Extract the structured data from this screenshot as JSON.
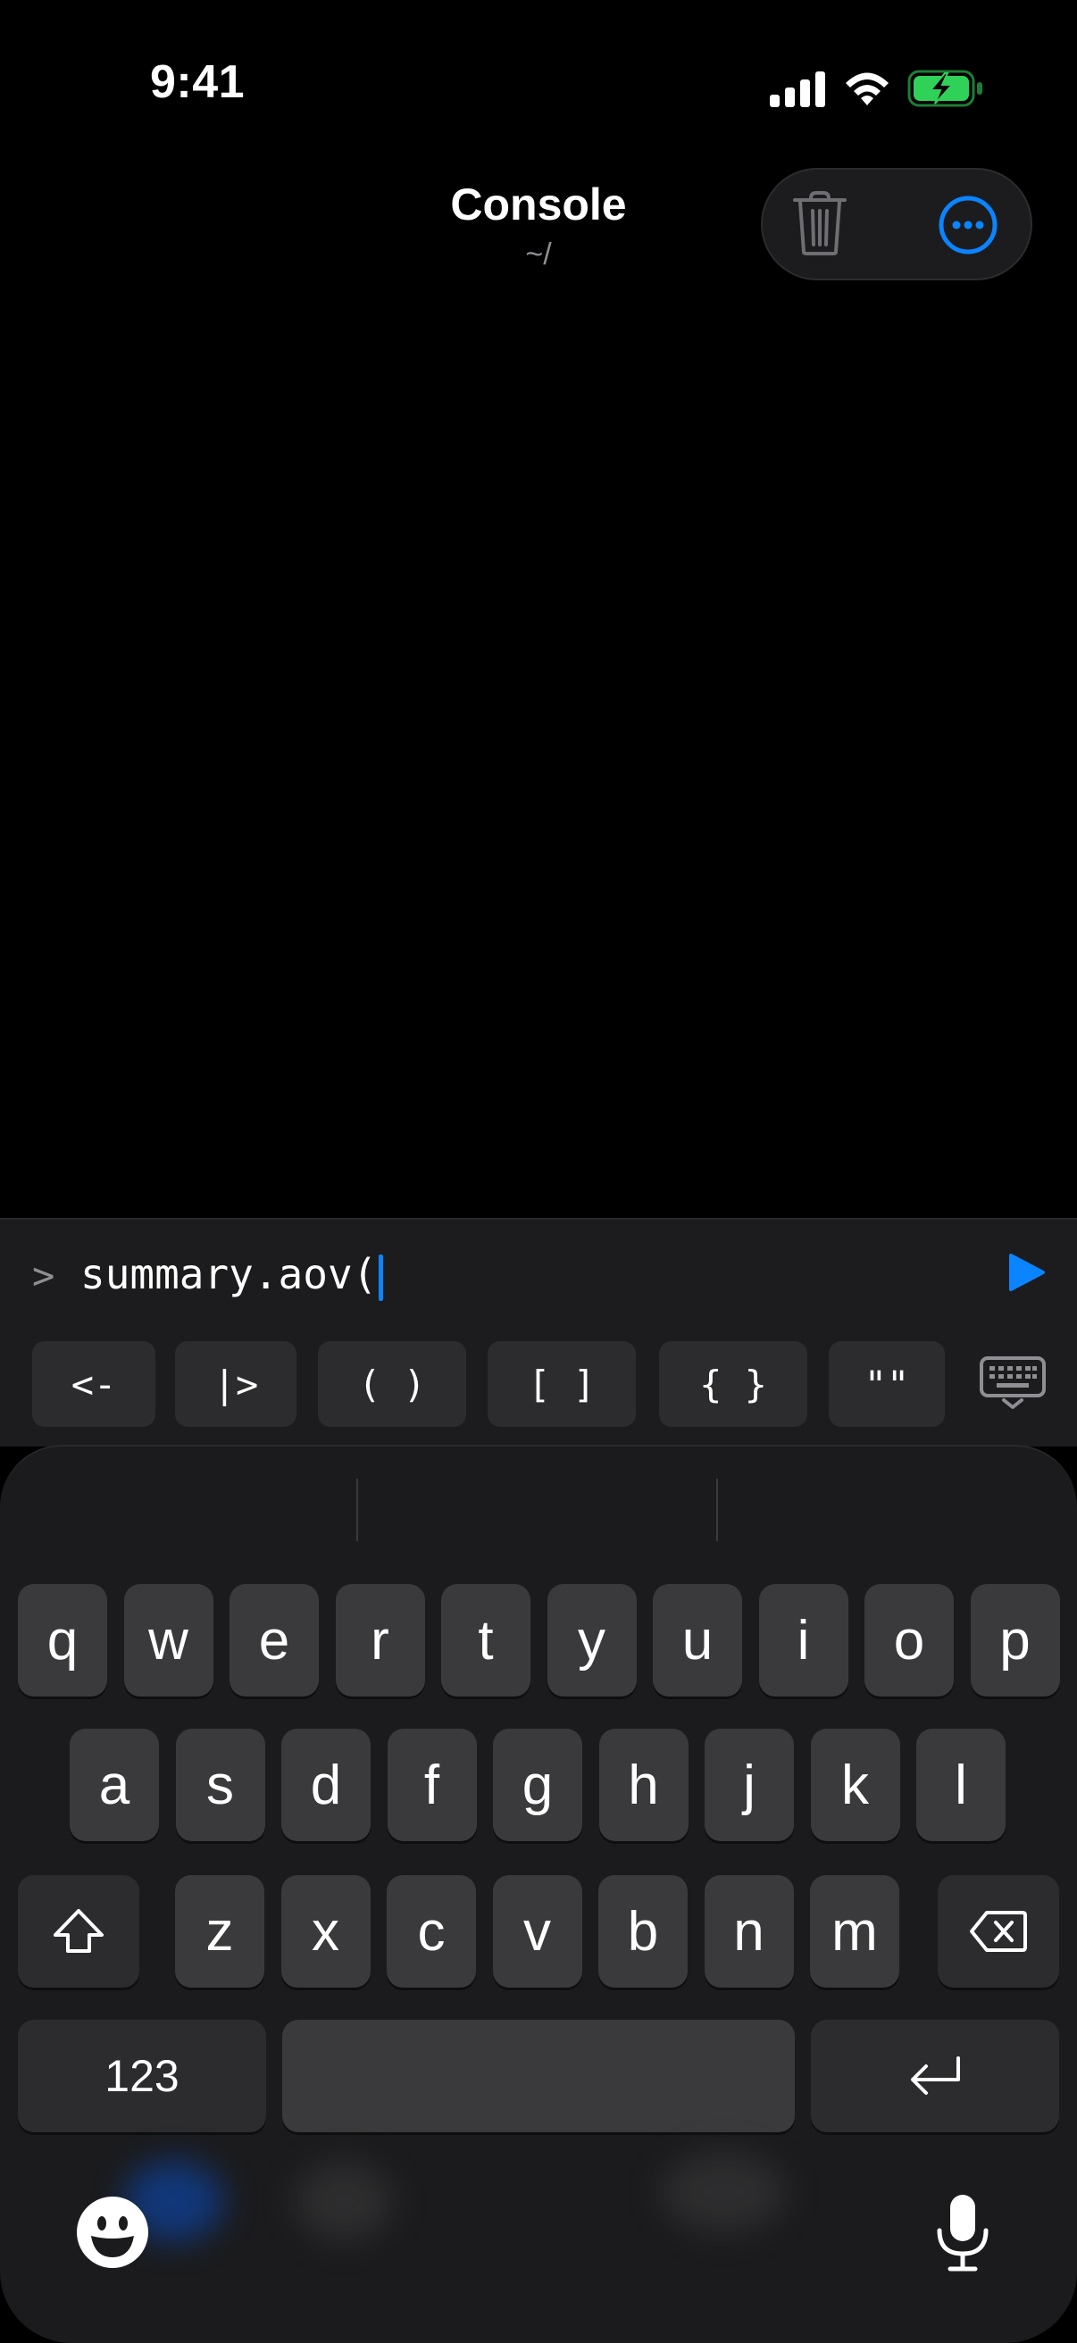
{
  "status_bar": {
    "time": "9:41",
    "icons": [
      "cellular-signal-icon",
      "wifi-icon",
      "battery-charging-icon"
    ],
    "battery_color": "#30d158"
  },
  "nav": {
    "title": "Console",
    "subtitle": "~/",
    "actions": [
      "trash-icon",
      "more-icon"
    ],
    "accent": "#0a84ff"
  },
  "console": {
    "prompt": ">",
    "command": "summary.aov(",
    "run_icon": "play-icon"
  },
  "accessory_keys": [
    "<-",
    "|>",
    "( )",
    "[ ]",
    "{ }",
    "\"\"",
    "keyboard-dismiss-icon"
  ],
  "keyboard": {
    "row1": [
      "q",
      "w",
      "e",
      "r",
      "t",
      "y",
      "u",
      "i",
      "o",
      "p"
    ],
    "row2": [
      "a",
      "s",
      "d",
      "f",
      "g",
      "h",
      "j",
      "k",
      "l"
    ],
    "row3": [
      "z",
      "x",
      "c",
      "v",
      "b",
      "n",
      "m"
    ],
    "numbers_label": "123",
    "shift_icon": "shift-icon",
    "delete_icon": "delete-icon",
    "return_icon": "return-icon",
    "emoji_icon": "emoji-icon",
    "mic_icon": "microphone-icon"
  }
}
